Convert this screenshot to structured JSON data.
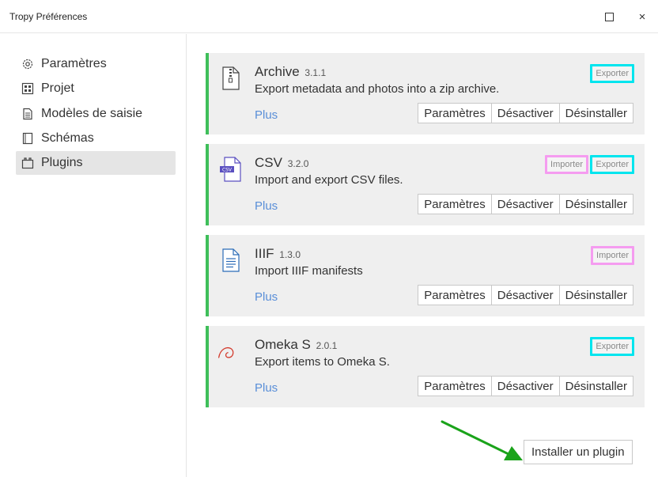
{
  "window": {
    "title": "Tropy Préférences",
    "close_glyph": "×"
  },
  "sidebar": {
    "items": [
      {
        "label": "Paramètres",
        "icon": "gear-icon"
      },
      {
        "label": "Projet",
        "icon": "project-icon"
      },
      {
        "label": "Modèles de saisie",
        "icon": "template-icon"
      },
      {
        "label": "Schémas",
        "icon": "vocabulary-icon"
      },
      {
        "label": "Plugins",
        "icon": "plugin-icon",
        "active": true
      }
    ]
  },
  "plugins": [
    {
      "name": "Archive",
      "version": "3.1.1",
      "description": "Export metadata and photos into a zip archive.",
      "tags": [
        "Exporter"
      ],
      "more": "Plus",
      "buttons": [
        "Paramètres",
        "Désactiver",
        "Désinstaller"
      ],
      "icon": "zip-file-icon"
    },
    {
      "name": "CSV",
      "version": "3.2.0",
      "description": "Import and export CSV files.",
      "tags": [
        "Importer",
        "Exporter"
      ],
      "more": "Plus",
      "buttons": [
        "Paramètres",
        "Désactiver",
        "Désinstaller"
      ],
      "icon": "csv-file-icon",
      "icon_text": "CSV"
    },
    {
      "name": "IIIF",
      "version": "1.3.0",
      "description": "Import IIIF manifests",
      "tags": [
        "Importer"
      ],
      "more": "Plus",
      "buttons": [
        "Paramètres",
        "Désactiver",
        "Désinstaller"
      ],
      "icon": "document-file-icon"
    },
    {
      "name": "Omeka S",
      "version": "2.0.1",
      "description": "Export items to Omeka S.",
      "tags": [
        "Exporter"
      ],
      "more": "Plus",
      "buttons": [
        "Paramètres",
        "Désactiver",
        "Désinstaller"
      ],
      "icon": "omeka-logo-icon"
    }
  ],
  "install_button": "Installer un plugin",
  "colors": {
    "card_accent": "#3fbf5a",
    "link": "#5a8fd8",
    "export_highlight": "#00e5ee",
    "import_highlight": "#f59cf0",
    "annotation_arrow": "#1aa31a"
  }
}
